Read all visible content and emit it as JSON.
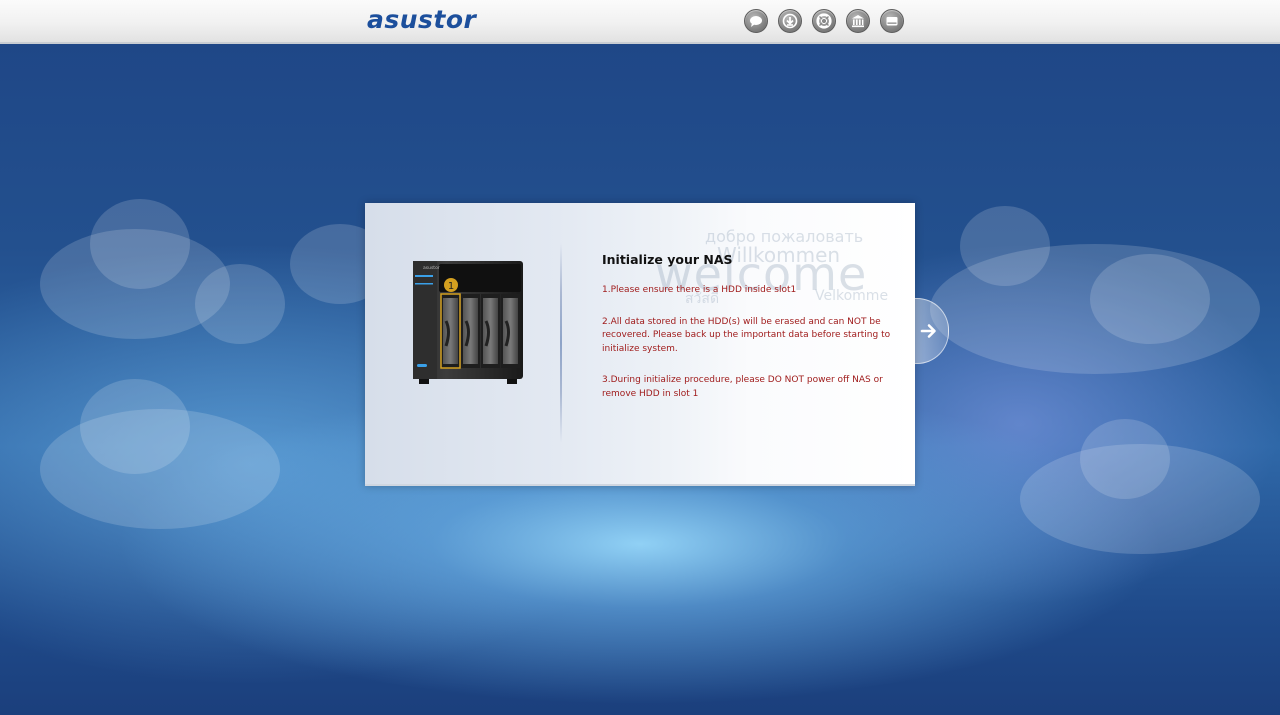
{
  "header": {
    "logo_text": "asustor",
    "icons": [
      "chat-icon",
      "download-icon",
      "help-lifebuoy-icon",
      "bank-icon",
      "storage-drive-icon"
    ]
  },
  "dialog": {
    "title": "Initialize your NAS",
    "steps": [
      "1.Please ensure there is a HDD inside slot1",
      "2.All data stored in the HDD(s) will be erased and can NOT be recovered. Please back up the important data before starting to initialize system.",
      "3.During initialize procedure, please DO NOT power off NAS or remove HDD in slot 1"
    ],
    "background_words": [
      "добро пожаловать",
      "Willkommen",
      "welcome",
      "Velkomme",
      "สวัสดี"
    ],
    "device_brand": "asustor",
    "device_slot_label": "1"
  },
  "colors": {
    "brand": "#1c4f9c",
    "warning_text": "#a01d1d",
    "background": "#23508e"
  }
}
